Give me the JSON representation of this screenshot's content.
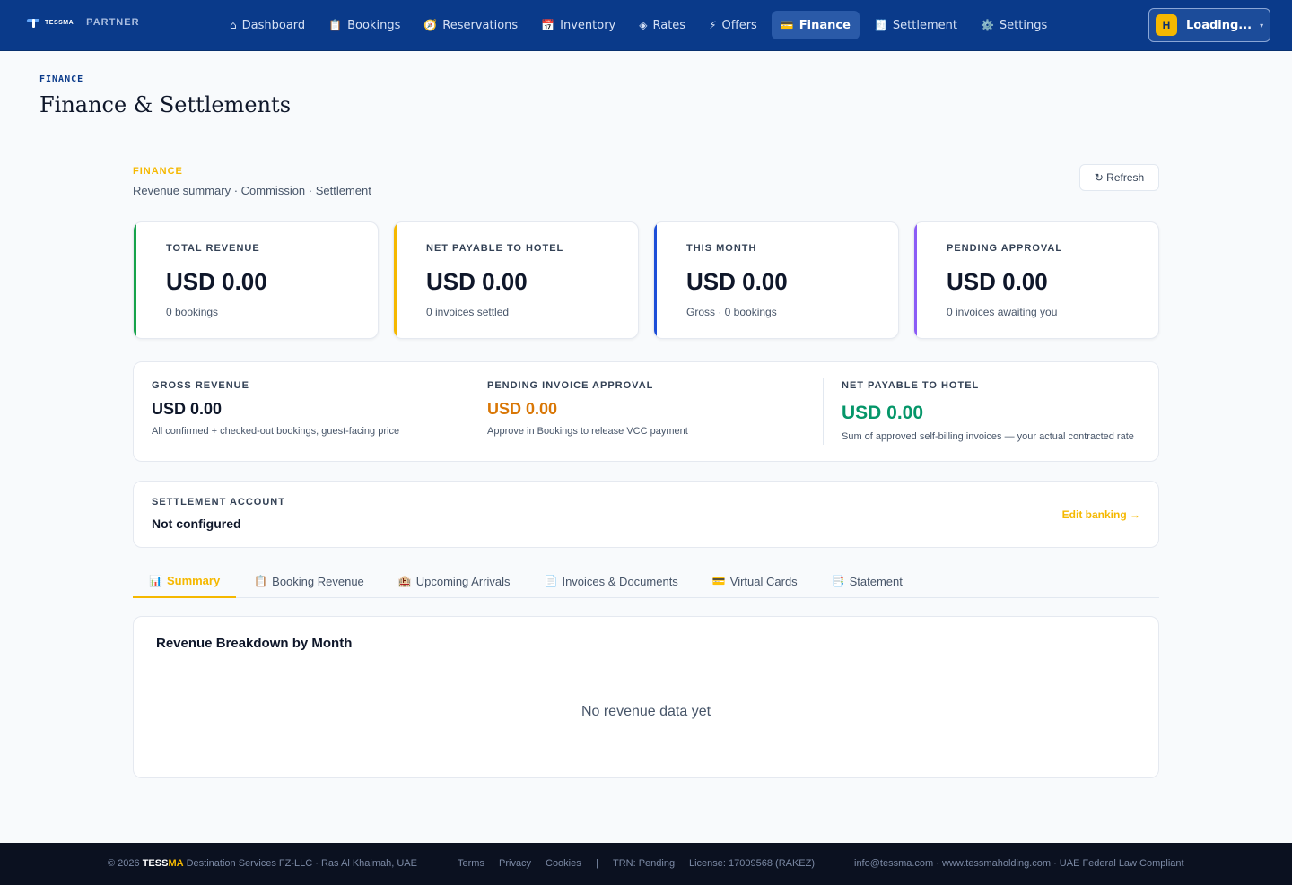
{
  "brand": {
    "name": "TESSMA",
    "partner": "PARTNER"
  },
  "nav": {
    "items": [
      {
        "icon": "⌂",
        "label": "Dashboard",
        "active": false
      },
      {
        "icon": "📋",
        "label": "Bookings",
        "active": false
      },
      {
        "icon": "🧭",
        "label": "Reservations",
        "active": false
      },
      {
        "icon": "📅",
        "label": "Inventory",
        "active": false
      },
      {
        "icon": "◈",
        "label": "Rates",
        "active": false
      },
      {
        "icon": "⚡",
        "label": "Offers",
        "active": false
      },
      {
        "icon": "💳",
        "label": "Finance",
        "active": true
      },
      {
        "icon": "🧾",
        "label": "Settlement",
        "active": false
      },
      {
        "icon": "⚙️",
        "label": "Settings",
        "active": false
      }
    ],
    "user": {
      "initial": "H",
      "name": "Loading...",
      "caret": "▾"
    }
  },
  "page": {
    "eyebrow": "FINANCE",
    "title": "Finance & Settlements"
  },
  "section": {
    "eyebrow": "FINANCE",
    "subtitle": "Revenue summary · Commission · Settlement",
    "refresh_label": "↻ Refresh"
  },
  "stats": [
    {
      "label": "TOTAL REVENUE",
      "value": "USD 0.00",
      "sub": "0 bookings",
      "color": "#16a34a"
    },
    {
      "label": "NET PAYABLE TO HOTEL",
      "value": "USD 0.00",
      "sub": "0 invoices settled",
      "color": "#f5b800"
    },
    {
      "label": "THIS MONTH",
      "value": "USD 0.00",
      "sub": "Gross · 0 bookings",
      "color": "#1d4ed8"
    },
    {
      "label": "PENDING APPROVAL",
      "value": "USD 0.00",
      "sub": "0 invoices awaiting you",
      "color": "#8b5cf6"
    }
  ],
  "summary": {
    "gross": {
      "label": "GROSS REVENUE",
      "value": "USD 0.00",
      "sub": "All confirmed + checked-out bookings, guest-facing price"
    },
    "pending": {
      "label": "PENDING INVOICE APPROVAL",
      "value": "USD 0.00",
      "sub": "Approve in Bookings to release VCC payment",
      "color": "#d97706"
    },
    "net": {
      "label": "NET PAYABLE TO HOTEL",
      "value": "USD 0.00",
      "sub": "Sum of approved self-billing invoices — your actual contracted rate",
      "color": "#059669"
    }
  },
  "settlement": {
    "label": "SETTLEMENT ACCOUNT",
    "value": "Not configured",
    "link": "Edit banking →"
  },
  "tabs": [
    {
      "icon": "📊",
      "label": "Summary",
      "active": true
    },
    {
      "icon": "📋",
      "label": "Booking Revenue",
      "active": false
    },
    {
      "icon": "🏨",
      "label": "Upcoming Arrivals",
      "active": false
    },
    {
      "icon": "📄",
      "label": "Invoices & Documents",
      "active": false
    },
    {
      "icon": "💳",
      "label": "Virtual Cards",
      "active": false
    },
    {
      "icon": "📑",
      "label": "Statement",
      "active": false
    }
  ],
  "breakdown": {
    "title": "Revenue Breakdown by Month",
    "empty": "No revenue data yet"
  },
  "footer": {
    "copyright_prefix": "© 2026",
    "tess": "TESS",
    "ma": "MA",
    "company": "Destination Services FZ-LLC · Ras Al Khaimah, UAE",
    "terms": "Terms",
    "privacy": "Privacy",
    "cookies": "Cookies",
    "sep": "|",
    "trn": "TRN: Pending",
    "license": "License: 17009568 (RAKEZ)",
    "contact": "info@tessma.com · www.tessmaholding.com · UAE Federal Law Compliant"
  }
}
